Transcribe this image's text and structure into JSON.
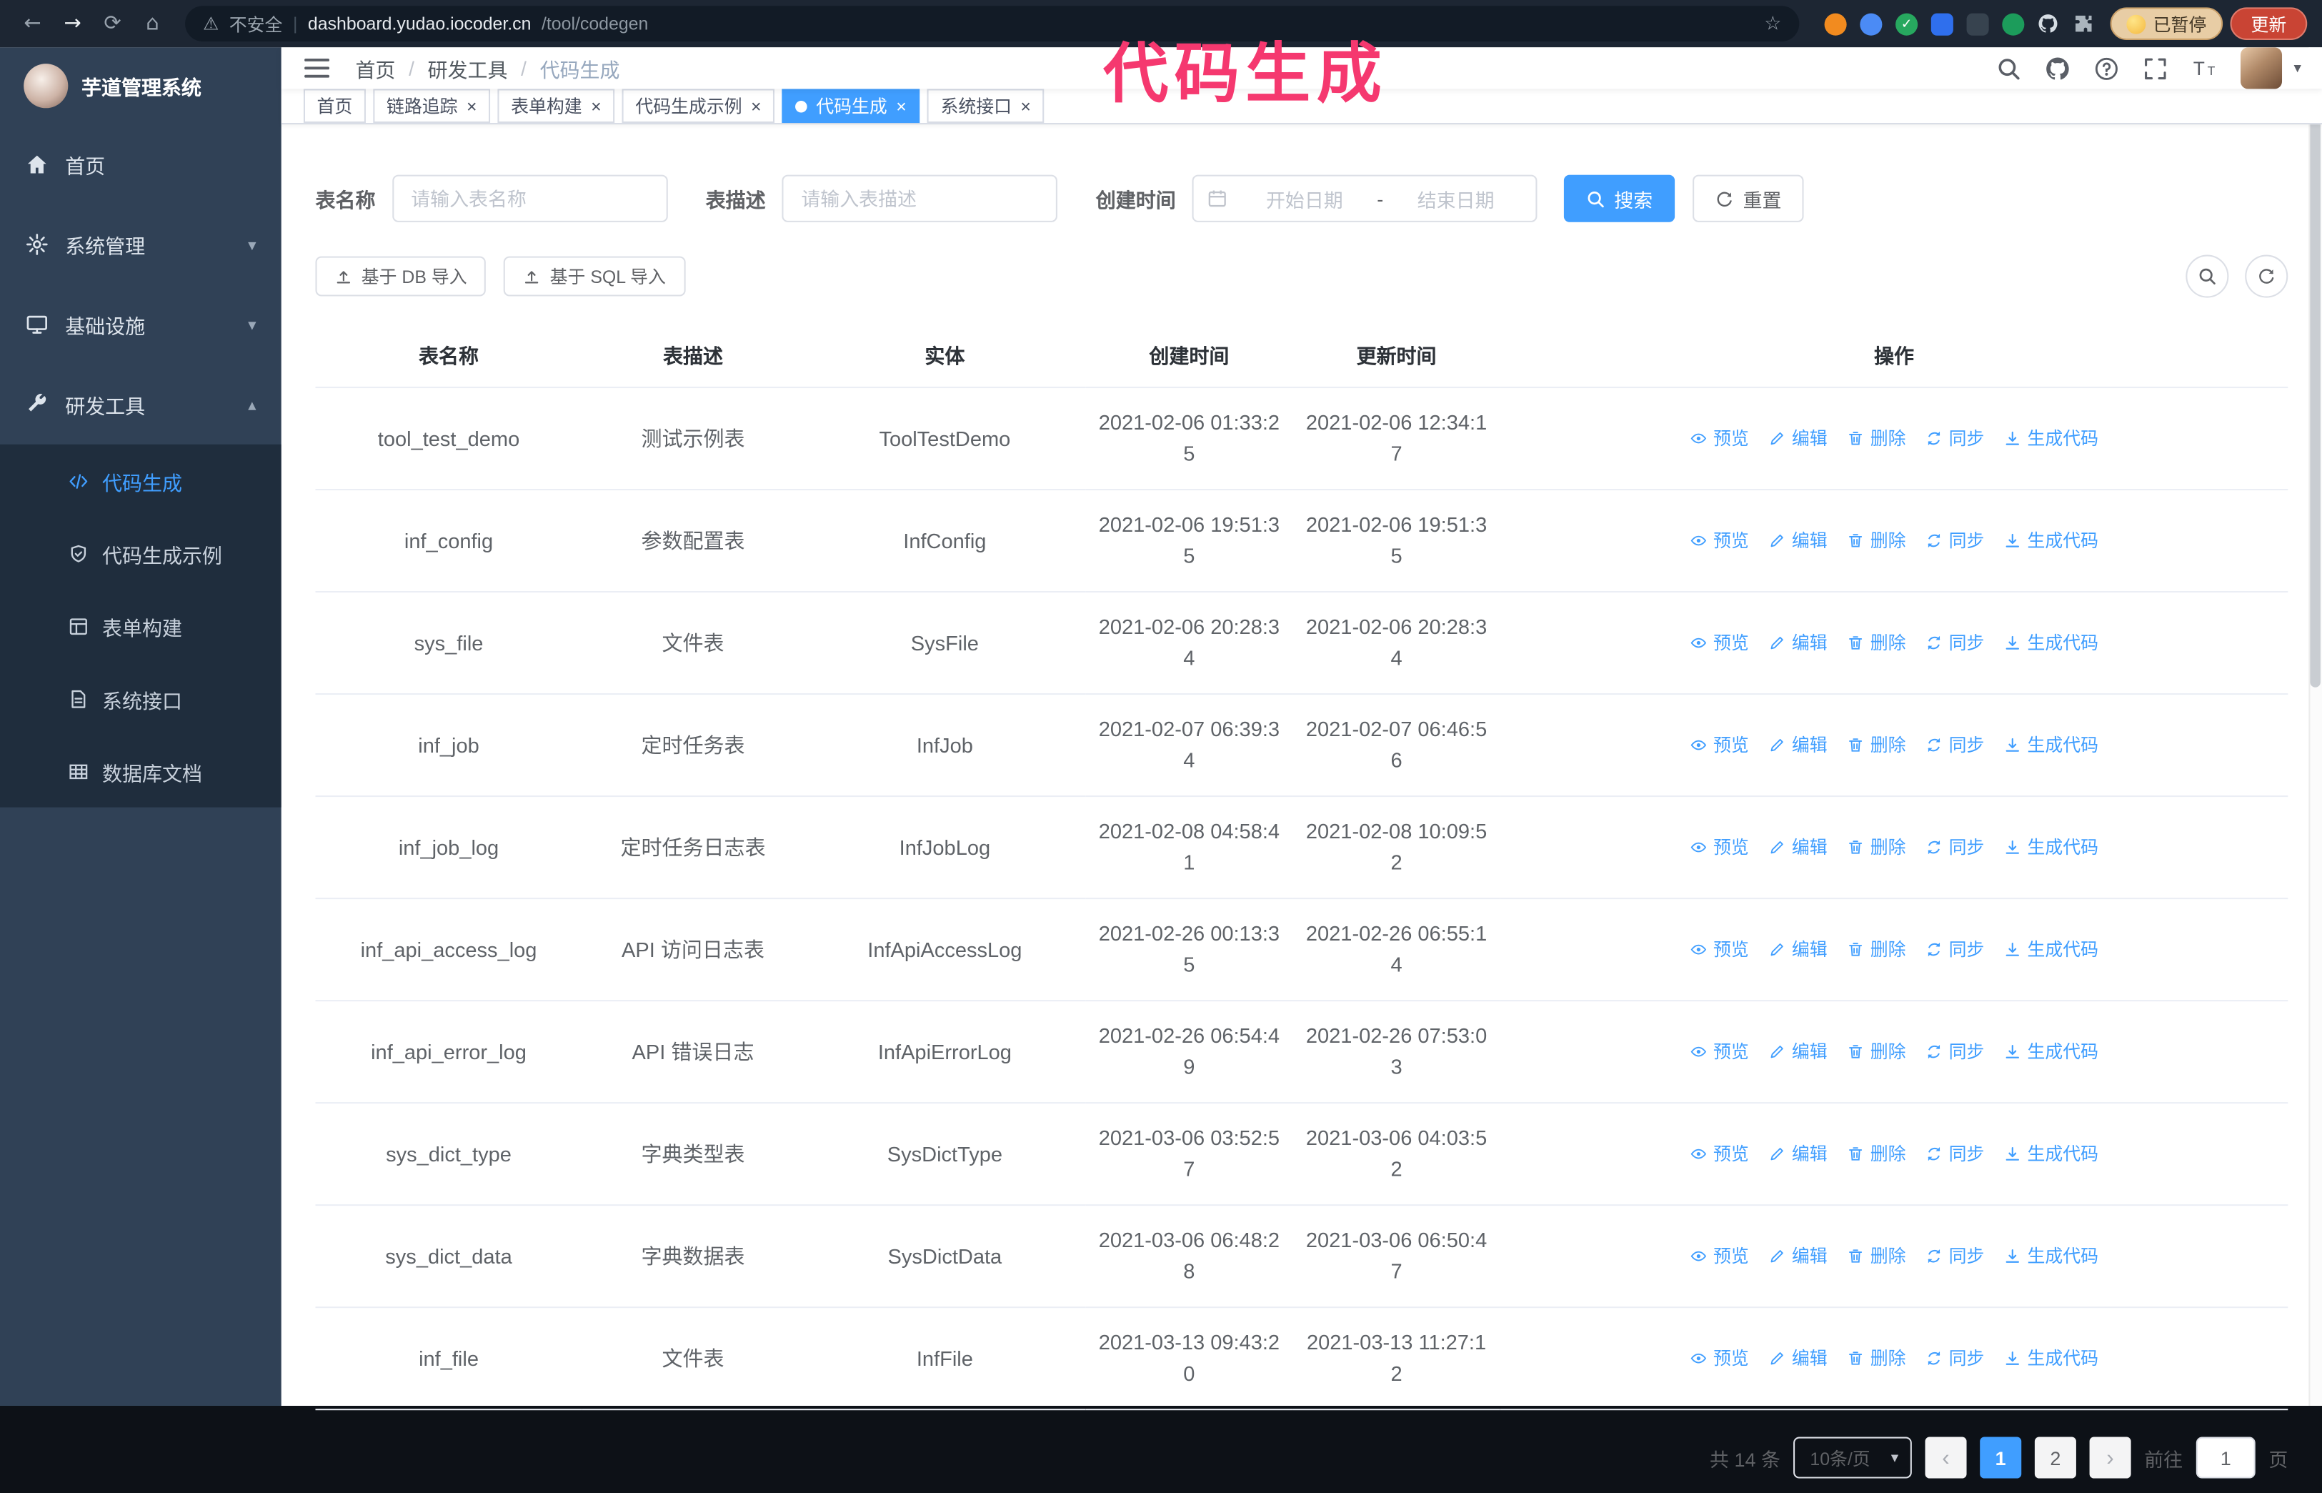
{
  "browser": {
    "security_text": "不安全",
    "url_domain": "dashboard.yudao.iocoder.cn",
    "url_path": "/tool/codegen",
    "paused_label": "已暂停",
    "update_label": "更新"
  },
  "annotation": {
    "text": "代码生成",
    "color": "#f5386f"
  },
  "icons": {
    "back": "←",
    "forward": "→",
    "reload": "⟳",
    "home": "⌂",
    "warning": "⚠",
    "pipe": "|",
    "star": "☆",
    "close": "×",
    "caret_down": "▾",
    "caret_up": "▴",
    "prev": "‹",
    "next": "›",
    "check": "✓"
  },
  "sidebar": {
    "logo_title": "芋道管理系统",
    "items": [
      {
        "label": "首页"
      },
      {
        "label": "系统管理"
      },
      {
        "label": "基础设施"
      },
      {
        "label": "研发工具"
      }
    ],
    "subitems": [
      {
        "label": "代码生成"
      },
      {
        "label": "代码生成示例"
      },
      {
        "label": "表单构建"
      },
      {
        "label": "系统接口"
      },
      {
        "label": "数据库文档"
      }
    ]
  },
  "header": {
    "breadcrumb": [
      "首页",
      "研发工具",
      "代码生成"
    ],
    "separator": "/"
  },
  "tabs": [
    {
      "label": "首页"
    },
    {
      "label": "链路追踪"
    },
    {
      "label": "表单构建"
    },
    {
      "label": "代码生成示例"
    },
    {
      "label": "代码生成"
    },
    {
      "label": "系统接口"
    }
  ],
  "filters": {
    "table_name_label": "表名称",
    "table_name_placeholder": "请输入表名称",
    "table_desc_label": "表描述",
    "table_desc_placeholder": "请输入表描述",
    "create_time_label": "创建时间",
    "date_start_placeholder": "开始日期",
    "date_separator": "-",
    "date_end_placeholder": "结束日期",
    "search_button": "搜索",
    "reset_button": "重置"
  },
  "toolbar": {
    "import_db": "基于 DB 导入",
    "import_sql": "基于 SQL 导入"
  },
  "table": {
    "columns": [
      "表名称",
      "表描述",
      "实体",
      "创建时间",
      "更新时间",
      "操作"
    ],
    "actions": [
      "预览",
      "编辑",
      "删除",
      "同步",
      "生成代码"
    ],
    "rows": [
      {
        "name": "tool_test_demo",
        "desc": "测试示例表",
        "entity": "ToolTestDemo",
        "created": "2021-02-06 01:33:25",
        "updated": "2021-02-06 12:34:17"
      },
      {
        "name": "inf_config",
        "desc": "参数配置表",
        "entity": "InfConfig",
        "created": "2021-02-06 19:51:35",
        "updated": "2021-02-06 19:51:35"
      },
      {
        "name": "sys_file",
        "desc": "文件表",
        "entity": "SysFile",
        "created": "2021-02-06 20:28:34",
        "updated": "2021-02-06 20:28:34"
      },
      {
        "name": "inf_job",
        "desc": "定时任务表",
        "entity": "InfJob",
        "created": "2021-02-07 06:39:34",
        "updated": "2021-02-07 06:46:56"
      },
      {
        "name": "inf_job_log",
        "desc": "定时任务日志表",
        "entity": "InfJobLog",
        "created": "2021-02-08 04:58:41",
        "updated": "2021-02-08 10:09:52"
      },
      {
        "name": "inf_api_access_log",
        "desc": "API 访问日志表",
        "entity": "InfApiAccessLog",
        "created": "2021-02-26 00:13:35",
        "updated": "2021-02-26 06:55:14"
      },
      {
        "name": "inf_api_error_log",
        "desc": "API 错误日志",
        "entity": "InfApiErrorLog",
        "created": "2021-02-26 06:54:49",
        "updated": "2021-02-26 07:53:03"
      },
      {
        "name": "sys_dict_type",
        "desc": "字典类型表",
        "entity": "SysDictType",
        "created": "2021-03-06 03:52:57",
        "updated": "2021-03-06 04:03:52"
      },
      {
        "name": "sys_dict_data",
        "desc": "字典数据表",
        "entity": "SysDictData",
        "created": "2021-03-06 06:48:28",
        "updated": "2021-03-06 06:50:47"
      },
      {
        "name": "inf_file",
        "desc": "文件表",
        "entity": "InfFile",
        "created": "2021-03-13 09:43:20",
        "updated": "2021-03-13 11:27:12"
      }
    ]
  },
  "pagination": {
    "total": "共 14 条",
    "page_size": "10条/页",
    "pages": [
      "1",
      "2"
    ],
    "goto_label": "前往",
    "goto_value": "1",
    "unit_label": "页"
  }
}
